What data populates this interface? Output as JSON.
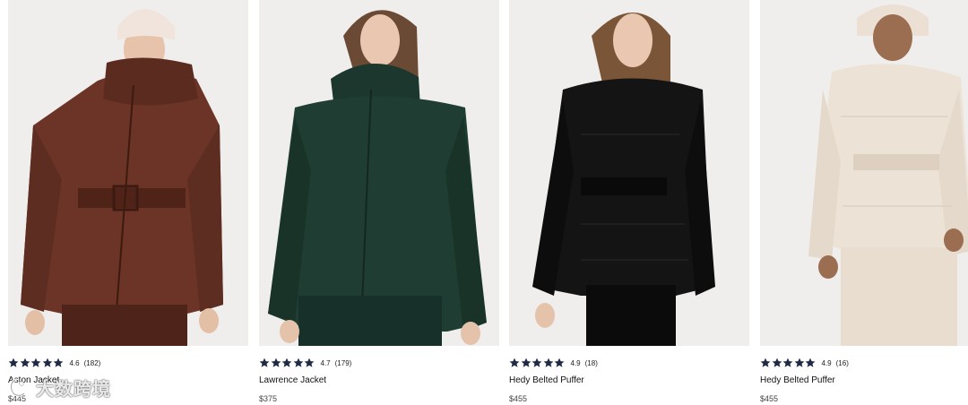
{
  "products": [
    {
      "name": "Aston Jacket",
      "rating": "4.6",
      "reviews": "(182)",
      "price": "$445",
      "color": "#6b3426"
    },
    {
      "name": "Lawrence Jacket",
      "rating": "4.7",
      "reviews": "(179)",
      "price": "$375",
      "color": "#1f3d33"
    },
    {
      "name": "Hedy Belted Puffer",
      "rating": "4.9",
      "reviews": "(18)",
      "price": "$455",
      "color": "#141414"
    },
    {
      "name": "Hedy Belted Puffer",
      "rating": "4.9",
      "reviews": "(16)",
      "price": "$455",
      "color": "#ece3d6"
    }
  ],
  "watermark": {
    "text": "大数跨境",
    "icon": "watermark-logo-icon"
  },
  "colors": {
    "star": "#1f2a44",
    "image_bg": "#ededee",
    "skin": "#e9c7b1"
  }
}
